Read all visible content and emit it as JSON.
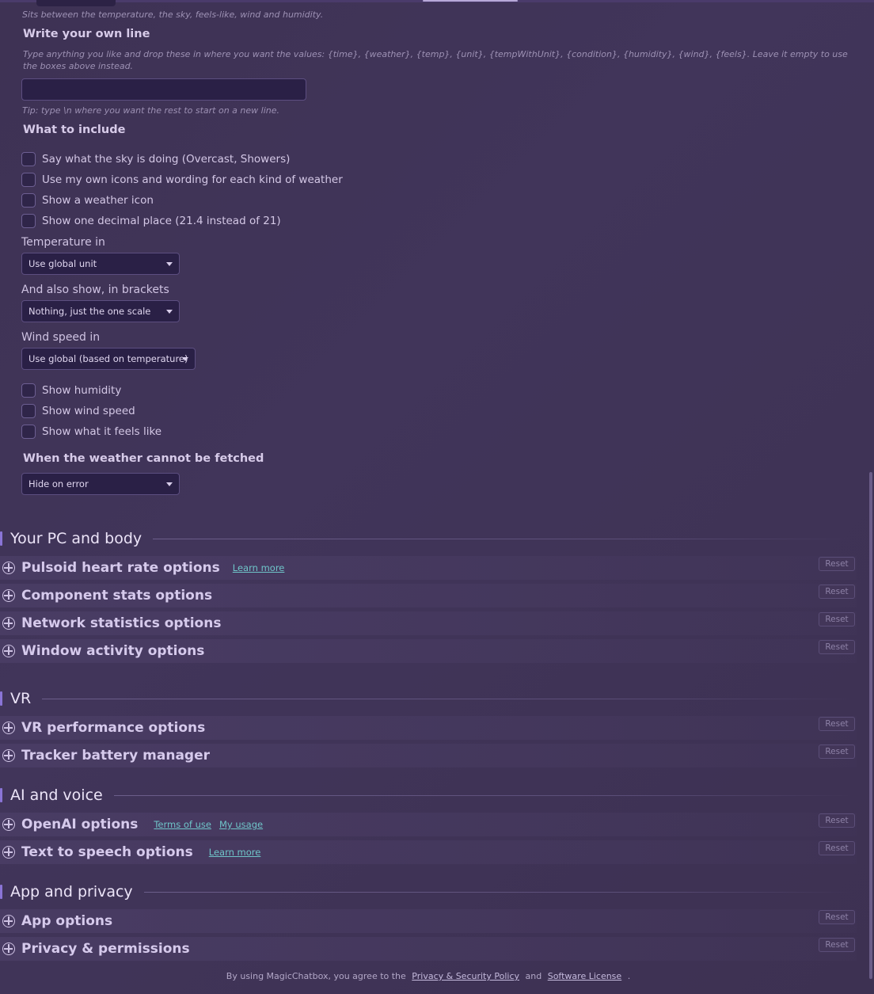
{
  "weather": {
    "top_hint": "Sits between the temperature, the sky, feels-like, wind and humidity.",
    "custom_line_label": "Write your own line",
    "custom_line_desc": "Type anything you like and drop these in where you want the values: {time}, {weather}, {temp}, {unit}, {tempWithUnit}, {condition}, {humidity}, {wind}, {feels}. Leave it empty to use the boxes above instead.",
    "custom_line_value": "",
    "custom_line_tip": "Tip: type \\n where you want the rest to start on a new line.",
    "include_label": "What to include",
    "include_options": [
      "Say what the sky is doing (Overcast, Showers)",
      "Use my own icons and wording for each kind of weather",
      "Show a weather icon",
      "Show one decimal place (21.4 instead of 21)"
    ],
    "temperature_label": "Temperature in",
    "temperature_value": "Use global unit",
    "brackets_label": "And also show, in brackets",
    "brackets_value": "Nothing, just the one scale",
    "wind_label": "Wind speed in",
    "wind_value": "Use global (based on temperature)",
    "extra_options": [
      "Show humidity",
      "Show wind speed",
      "Show what it feels like"
    ],
    "error_label": "When the weather cannot be fetched",
    "error_value": "Hide on error"
  },
  "sections": {
    "pc": {
      "title": "Your PC and body",
      "items": [
        {
          "title": "Pulsoid heart rate options",
          "links": [
            "Learn more"
          ]
        },
        {
          "title": "Component stats options",
          "links": []
        },
        {
          "title": "Network statistics options",
          "links": []
        },
        {
          "title": "Window activity options",
          "links": []
        }
      ]
    },
    "vr": {
      "title": "VR",
      "items": [
        {
          "title": "VR performance options",
          "links": []
        },
        {
          "title": "Tracker battery manager",
          "links": []
        }
      ]
    },
    "ai": {
      "title": "AI and voice",
      "items": [
        {
          "title": "OpenAI options",
          "links": [
            "Terms of use",
            "My usage"
          ]
        },
        {
          "title": "Text to speech options",
          "links": [
            "Learn more"
          ]
        }
      ]
    },
    "app": {
      "title": "App and privacy",
      "items": [
        {
          "title": "App options",
          "links": []
        },
        {
          "title": "Privacy & permissions",
          "links": []
        }
      ]
    }
  },
  "reset_label": "Reset",
  "footer": {
    "prefix": "By using MagicChatbox, you agree to the",
    "privacy_link": "Privacy & Security Policy",
    "and": "and",
    "license_link": "Software License",
    "suffix": "."
  },
  "icons": {
    "expand": "plus-circle-icon",
    "dropdown": "caret-down-icon"
  }
}
